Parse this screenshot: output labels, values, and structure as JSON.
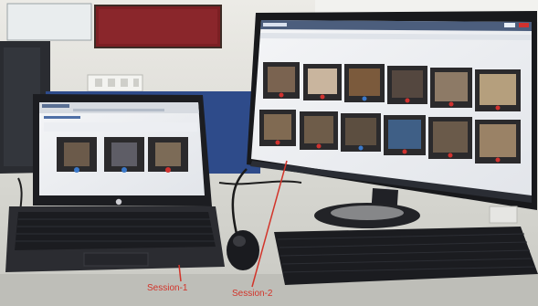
{
  "annotations": {
    "session_1_label": "Session-1",
    "session_2_label": "Session-2",
    "annotation_color": "#d2342a"
  },
  "laptop_screen": {
    "app_name": "VidPrompt",
    "visible_video_tiles": 3
  },
  "monitor_screen": {
    "app_name": "VidPrompt",
    "visible_video_tiles": 12,
    "grid": {
      "rows": 2,
      "columns": 6
    }
  },
  "icons": [
    "microphone-icon",
    "camera-icon",
    "monitor-brand-logo"
  ]
}
